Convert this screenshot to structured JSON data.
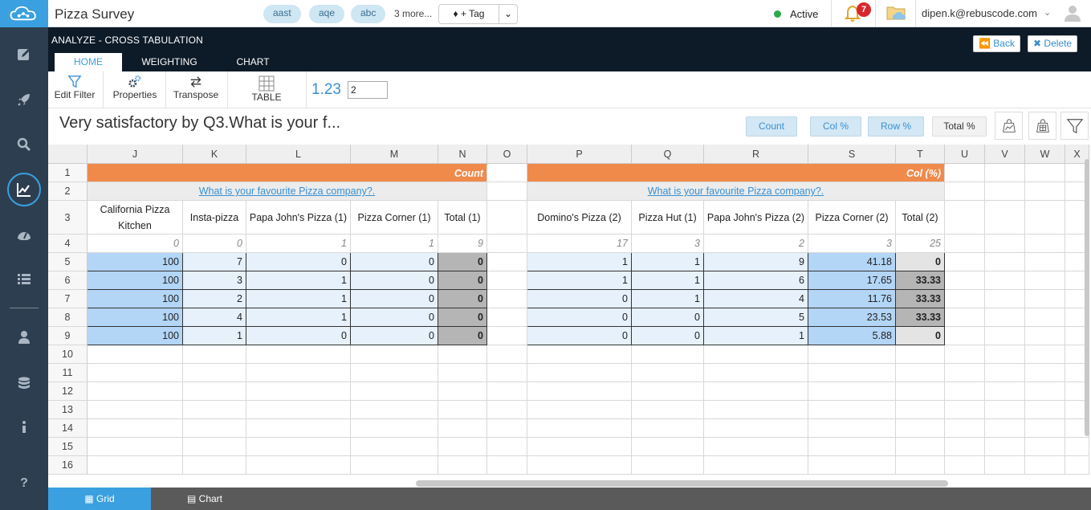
{
  "app": {
    "title": "Pizza Survey"
  },
  "tags": {
    "items": [
      "aast",
      "aqe",
      "abc"
    ],
    "more": "3 more...",
    "add_label": "+ Tag"
  },
  "status": {
    "label": "Active",
    "color": "#2aa84a"
  },
  "notifications": {
    "count": "7"
  },
  "user": {
    "email": "dipen.k@rebuscode.com"
  },
  "section": {
    "title": "ANALYZE - CROSS TABULATION"
  },
  "tabs": [
    {
      "label": "HOME",
      "active": true
    },
    {
      "label": "WEIGHTING"
    },
    {
      "label": "CHART"
    }
  ],
  "actions": {
    "back": "Back",
    "delete": "Delete"
  },
  "toolbar": {
    "edit_filter": "Edit Filter",
    "properties": "Properties",
    "transpose": "Transpose",
    "table": "TABLE",
    "decimals_label": "1.23",
    "decimals_value": "2"
  },
  "table": {
    "title": "Very satisfactory by Q3.What is your f...",
    "buttons": [
      "Count",
      "Col %",
      "Row %",
      "Total %"
    ],
    "columns": [
      "J",
      "K",
      "L",
      "M",
      "N",
      "O",
      "P",
      "Q",
      "R",
      "S",
      "T",
      "U",
      "V",
      "W",
      "X"
    ],
    "rows": [
      "1",
      "2",
      "3",
      "4",
      "5",
      "6",
      "7",
      "8",
      "9",
      "10",
      "11",
      "12",
      "13",
      "14",
      "15",
      "16"
    ],
    "left": {
      "band": "Count",
      "question": "What is your favourite Pizza company?.",
      "headers": [
        "California Pizza Kitchen",
        "Insta-pizza",
        "Papa John's Pizza (1)",
        "Pizza Corner (1)",
        "Total (1)"
      ],
      "bases": [
        "0",
        "0",
        "1",
        "1",
        "9"
      ],
      "data": [
        [
          "100",
          "7",
          "0",
          "0",
          "0"
        ],
        [
          "100",
          "3",
          "1",
          "0",
          "0"
        ],
        [
          "100",
          "2",
          "1",
          "0",
          "0"
        ],
        [
          "100",
          "4",
          "1",
          "0",
          "0"
        ],
        [
          "100",
          "1",
          "0",
          "0",
          "0"
        ]
      ]
    },
    "right": {
      "band": "Col (%)",
      "question": "What is your favourite Pizza company?.",
      "headers": [
        "Domino's Pizza (2)",
        "Pizza Hut (1)",
        "Papa John's Pizza (2)",
        "Pizza Corner (2)",
        "Total (2)"
      ],
      "bases": [
        "17",
        "3",
        "2",
        "3",
        "25"
      ],
      "data": [
        [
          "1",
          "1",
          "9",
          "41.18",
          "0"
        ],
        [
          "1",
          "1",
          "6",
          "17.65",
          "33.33"
        ],
        [
          "0",
          "1",
          "4",
          "11.76",
          "33.33"
        ],
        [
          "0",
          "0",
          "5",
          "23.53",
          "33.33"
        ],
        [
          "0",
          "0",
          "1",
          "5.88",
          "0"
        ]
      ]
    }
  },
  "bottom_tabs": [
    {
      "label": "Grid",
      "active": true
    },
    {
      "label": "Chart"
    }
  ],
  "colors": {
    "accent": "#3aa0e0",
    "band": "#f08a4b",
    "sidebar": "#2d3e50",
    "header": "#0d1a27"
  }
}
